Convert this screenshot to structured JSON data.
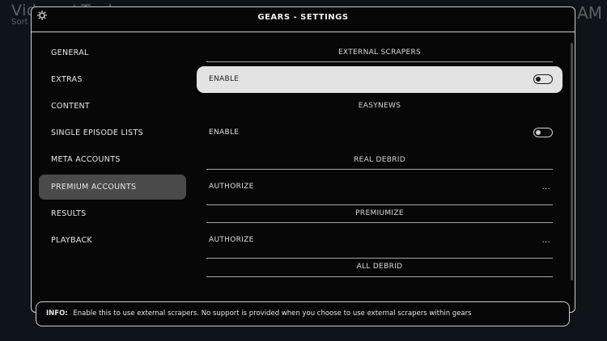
{
  "background": {
    "title": "Videos / Tools",
    "subtitle": "Sort",
    "right_text": "AM"
  },
  "dialog": {
    "title": "GEARS - SETTINGS",
    "header_icon": "gear-icon"
  },
  "nav": {
    "items": [
      {
        "label": "GENERAL"
      },
      {
        "label": "EXTRAS"
      },
      {
        "label": "CONTENT"
      },
      {
        "label": "SINGLE EPISODE LISTS"
      },
      {
        "label": "META ACCOUNTS"
      },
      {
        "label": "PREMIUM ACCOUNTS",
        "active": true
      },
      {
        "label": "RESULTS"
      },
      {
        "label": "PLAYBACK"
      }
    ]
  },
  "settings": {
    "sections": [
      {
        "header": "EXTERNAL SCRAPERS",
        "row_label": "ENABLE",
        "control": "toggle",
        "toggle_on": false,
        "focused": true
      },
      {
        "header": "EASYNEWS",
        "row_label": "ENABLE",
        "control": "toggle",
        "toggle_on": false
      },
      {
        "header": "REAL DEBRID",
        "row_label": "AUTHORIZE",
        "control": "ellipsis",
        "ellipsis": "..."
      },
      {
        "header": "PREMIUMIZE",
        "row_label": "AUTHORIZE",
        "control": "ellipsis",
        "ellipsis": "..."
      },
      {
        "header": "ALL DEBRID"
      }
    ]
  },
  "info": {
    "label": "INFO:",
    "text": "Enable this to use external scrapers. No support is provided when you choose to use external scrapers within gears"
  },
  "colors": {
    "background": "#0e1419",
    "dialog": "#070707",
    "focused_row": "#e3e3e3",
    "active_nav": "#4a4a4a"
  }
}
